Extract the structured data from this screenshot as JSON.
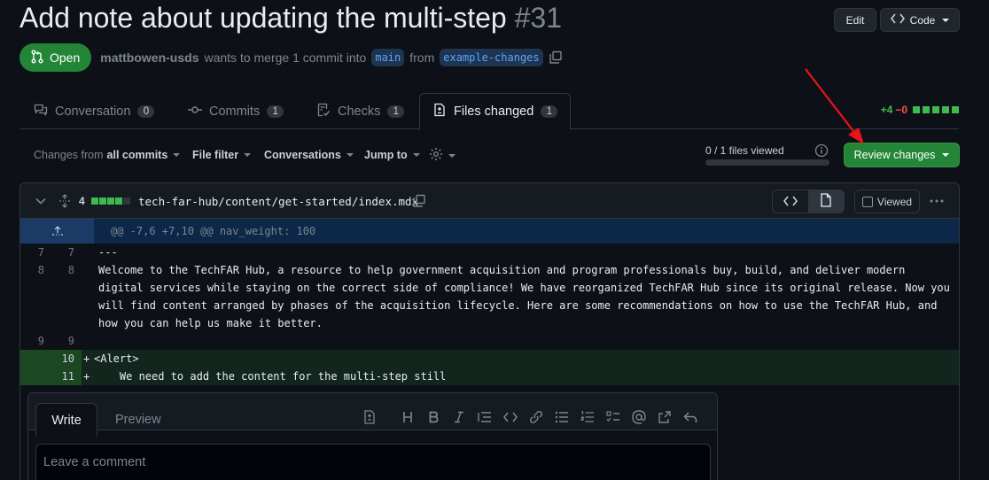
{
  "header": {
    "title": "Add note about updating the multi-step",
    "number": "#31",
    "edit_label": "Edit",
    "code_label": "Code"
  },
  "meta": {
    "state": "Open",
    "author": "mattbowen-usds",
    "text_merge": "wants to merge 1 commit into",
    "base_branch": "main",
    "text_from": "from",
    "head_branch": "example-changes"
  },
  "tabs": [
    {
      "label": "Conversation",
      "count": "0",
      "icon": "comment-discussion-icon"
    },
    {
      "label": "Commits",
      "count": "1",
      "icon": "git-commit-icon"
    },
    {
      "label": "Checks",
      "count": "1",
      "icon": "checklist-icon"
    },
    {
      "label": "Files changed",
      "count": "1",
      "icon": "file-diff-icon"
    }
  ],
  "diffstat": {
    "additions": "+4",
    "deletions": "−0"
  },
  "toolbar": {
    "changes_from_prefix": "Changes from",
    "changes_from_value": "all commits",
    "file_filter": "File filter",
    "conversations": "Conversations",
    "jump_to": "Jump to",
    "files_viewed": "0 / 1 files viewed",
    "review_button": "Review changes"
  },
  "file": {
    "change_count": "4",
    "path": "tech-far-hub/content/get-started/index.mdx",
    "viewed_label": "Viewed"
  },
  "diff": {
    "hunk": "@@ -7,6 +7,10 @@ nav_weight: 100",
    "lines": [
      {
        "old": "7",
        "new": "7",
        "type": "ctx",
        "text": "---"
      },
      {
        "old": "8",
        "new": "8",
        "type": "ctx",
        "text": "Welcome to the TechFAR Hub, a resource to help government acquisition and program professionals buy, build, and deliver modern digital services while staying on the correct side of compliance! We have reorganized TechFAR Hub since its original release. Now you will find content arranged by phases of the acquisition lifecycle. Here are some recommendations on how to use the TechFAR Hub, and how you can help us make it better."
      },
      {
        "old": "9",
        "new": "9",
        "type": "ctx",
        "text": ""
      },
      {
        "old": "",
        "new": "10",
        "type": "add",
        "text": "<Alert>"
      },
      {
        "old": "",
        "new": "11",
        "type": "add",
        "text": "    We need to add the content for the multi-step still"
      }
    ]
  },
  "comment": {
    "write_tab": "Write",
    "preview_tab": "Preview",
    "placeholder": "Leave a comment"
  },
  "colors": {
    "accent_green": "#238636",
    "annotation_arrow": "#e8141a"
  }
}
